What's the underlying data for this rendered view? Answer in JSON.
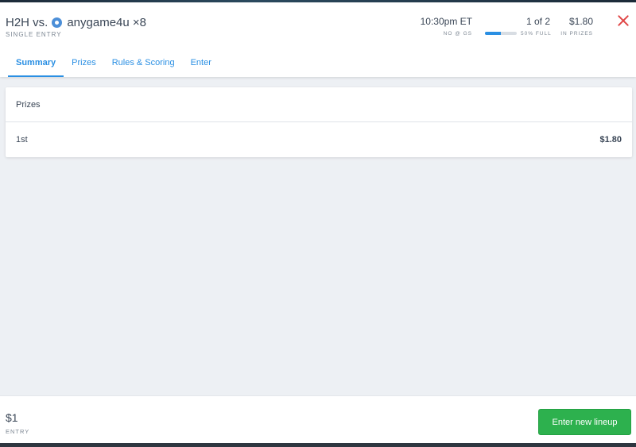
{
  "header": {
    "title_prefix": "H2H vs.",
    "opponent": "anygame4u ×8",
    "subtitle": "SINGLE ENTRY",
    "time": {
      "value": "10:30pm ET",
      "label": "NO @ GS"
    },
    "entries": {
      "value": "1 of 2",
      "label": "50% FULL",
      "fill_fraction": 0.5
    },
    "prizes": {
      "value": "$1.80",
      "label": "IN PRIZES"
    }
  },
  "tabs": [
    {
      "label": "Summary",
      "active": true
    },
    {
      "label": "Prizes"
    },
    {
      "label": "Rules & Scoring"
    },
    {
      "label": "Enter"
    }
  ],
  "prize_card": {
    "title": "Prizes",
    "rows": [
      {
        "place": "1st",
        "amount": "$1.80"
      }
    ]
  },
  "footer": {
    "entry_fee": "$1",
    "entry_label": "ENTRY",
    "button_label": "Enter new lineup"
  },
  "colors": {
    "accent": "#2a8fe3",
    "button_green": "#2db14e",
    "close_red": "#e04646",
    "page_bg": "#edf0f4"
  },
  "icons": {
    "close": "close-icon",
    "opponent": "opponent-badge-icon"
  }
}
